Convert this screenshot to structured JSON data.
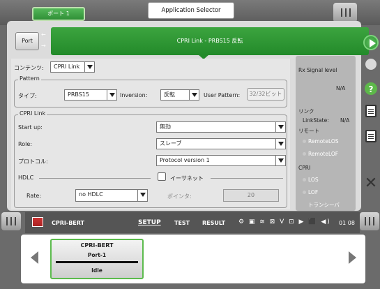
{
  "top": {
    "port_tab": "ポート 1",
    "app_selector": "Application Selector"
  },
  "header": {
    "port_button": "Port",
    "banner": "CPRI Link - PRBS15 反転"
  },
  "content": {
    "label": "コンテンツ:",
    "value": "CPRI Link"
  },
  "pattern": {
    "group_title": "Pattern",
    "type_label": "タイプ:",
    "type_value": "PRBS15",
    "inversion_label": "Inversion:",
    "inversion_value": "反転",
    "user_pattern_label": "User Pattern:",
    "user_pattern_value": "32/32ビット"
  },
  "cpri_link": {
    "group_title": "CPRI Link",
    "startup_label": "Start up:",
    "startup_value": "無効",
    "role_label": "Role:",
    "role_value": "スレーブ",
    "protocol_label": "プロトコル:",
    "protocol_value": "Protocol version 1",
    "hdlc_title": "HDLC",
    "ethernet_label": "イーサネット",
    "rate_label": "Rate:",
    "rate_value": "no HDLC",
    "pointer_label": "ポインタ:",
    "pointer_value": "20"
  },
  "signal": {
    "rx_signal_level": "Rx Signal level",
    "rx_value": "N/A",
    "link_title": "リンク",
    "link_state_label": "LinkState:",
    "link_state_value": "N/A",
    "remote_title": "リモート",
    "remote_los": "RemoteLOS",
    "remote_lof": "RemoteLOF",
    "cpri_title": "CPRI",
    "los": "LOS",
    "lof": "LOF",
    "transceiver": "トランシーバ"
  },
  "bottom_strip": {
    "app_name": "CPRI-BERT",
    "tab_setup": "SETUP",
    "tab_test": "TEST",
    "tab_result": "RESULT",
    "time": "01 08"
  },
  "card": {
    "title": "CPRI-BERT",
    "port": "Port-1",
    "status": "Idle"
  },
  "icons": [
    "play-icon",
    "status-dot-icon",
    "help-icon",
    "document-icon",
    "edit-document-icon",
    "close-icon",
    "chevron-left-icon",
    "chevron-right-icon"
  ]
}
